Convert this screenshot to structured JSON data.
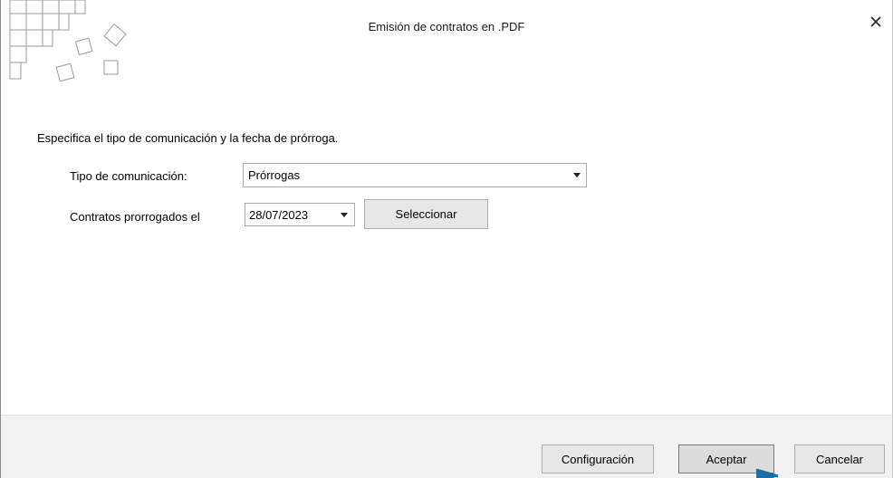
{
  "window": {
    "title": "Emisión de contratos en .PDF",
    "close_icon": "close-icon"
  },
  "main": {
    "instruction": "Especifica el tipo de comunicación y la fecha de prórroga.",
    "tipo_label": "Tipo de comunicación:",
    "tipo_value": "Prórrogas",
    "prorrogados_label": "Contratos prorrogados el",
    "date_value": "28/07/2023",
    "select_button": "Seleccionar"
  },
  "footer": {
    "config_button": "Configuración",
    "accept_button": "Aceptar",
    "cancel_button": "Cancelar"
  },
  "colors": {
    "footer_bg": "#f2f2f2",
    "button_bg": "#e7e7e7",
    "pointer": "#1a6fa8"
  }
}
